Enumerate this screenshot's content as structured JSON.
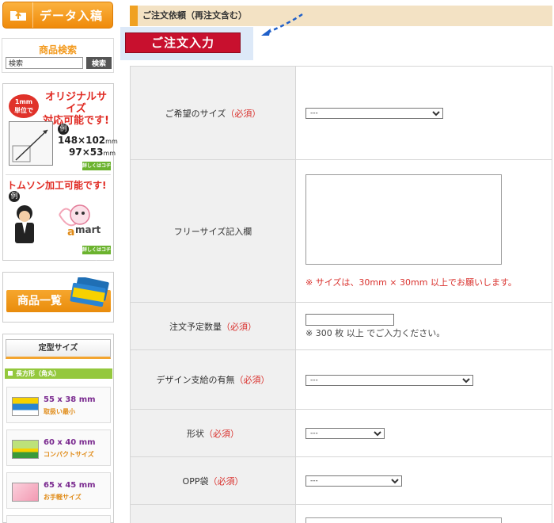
{
  "sidebar": {
    "data_button": {
      "label": "データ入稿",
      "icon": "folder-upload-icon"
    },
    "search": {
      "title": "商品検索",
      "placeholder": "検索",
      "value": "検索",
      "button_label": "検索"
    },
    "promo_original": {
      "badge": "1mm\n単位で",
      "headline_line1": "オリジナルサイズ",
      "headline_line2": "対応可能です!",
      "example_mark": "例",
      "size1": "148×102",
      "size2": "97×53",
      "unit": "mm",
      "more_label": "詳しくはコチラ"
    },
    "promo_thomson": {
      "headline": "トムソン加工可能です!",
      "example_mark": "例",
      "brand": "mart",
      "more_label": "詳しくはコチラ"
    },
    "product_list": {
      "label": "商品一覧"
    },
    "standard_sizes": {
      "heading": "定型サイズ",
      "category": "長方形（角丸）",
      "items": [
        {
          "dim": "55 x 38 mm",
          "sub": "取扱い最小"
        },
        {
          "dim": "60 x 40 mm",
          "sub": "コンパクトサイズ"
        },
        {
          "dim": "65 x 45 mm",
          "sub": "お手軽サイズ"
        }
      ]
    }
  },
  "main": {
    "section_title": "ご注文依頼（再注文含む）",
    "order_button": "ご注文入力",
    "required_mark": "（必須）",
    "fields": {
      "size": {
        "label": "ご希望のサイズ",
        "value": "---"
      },
      "free_size": {
        "label": "フリーサイズ記入欄",
        "note": "※ サイズは、30mm × 30mm 以上でお願いします。"
      },
      "quantity": {
        "label": "注文予定数量",
        "note": "※ 300 枚 以上 でご入力ください。"
      },
      "design": {
        "label": "デザイン支給の有無",
        "value": "---"
      },
      "shape": {
        "label": "形状",
        "value": "---"
      },
      "opp": {
        "label": "OPP袋",
        "value": "---"
      }
    }
  },
  "colors": {
    "accent_orange": "#f0a122",
    "order_red": "#c8102e",
    "required_red": "#d9302c",
    "header_beige": "#f3e2c4"
  }
}
